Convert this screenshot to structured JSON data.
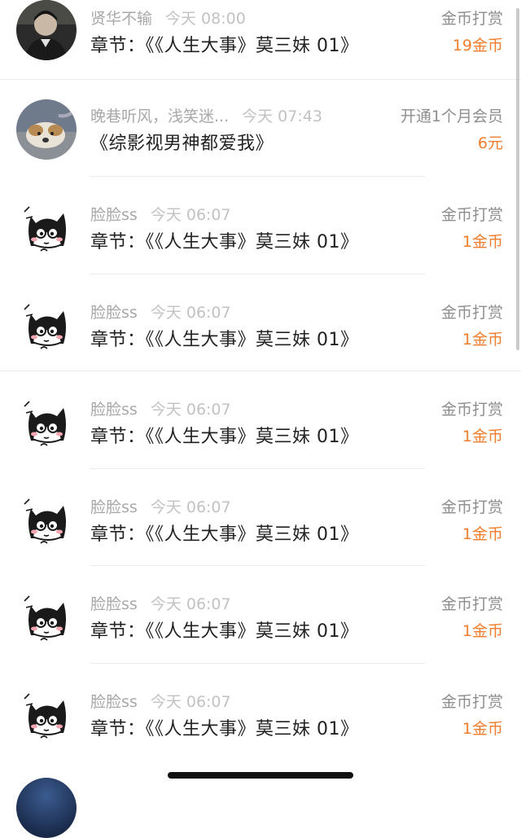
{
  "rows": [
    {
      "user": "贤华不输",
      "time": "今天 08:00",
      "content": "章节：《《人生大事》莫三妹 01》",
      "type": "金币打赏",
      "amount": "19金币",
      "avatar": "photo-man-icon"
    },
    {
      "user": "晚巷听风，浅笑迷...",
      "time": "今天 07:43",
      "content": "《综影视男神都爱我》",
      "type": "开通1个月会员",
      "amount": "6元",
      "avatar": "photo-dog-icon"
    },
    {
      "user": "脸脸ss",
      "time": "今天 06:07",
      "content": "章节：《《人生大事》莫三妹 01》",
      "type": "金币打赏",
      "amount": "1金币",
      "avatar": "cat-sticker-icon"
    },
    {
      "user": "脸脸ss",
      "time": "今天 06:07",
      "content": "章节：《《人生大事》莫三妹 01》",
      "type": "金币打赏",
      "amount": "1金币",
      "avatar": "cat-sticker-icon"
    },
    {
      "user": "脸脸ss",
      "time": "今天 06:07",
      "content": "章节：《《人生大事》莫三妹 01》",
      "type": "金币打赏",
      "amount": "1金币",
      "avatar": "cat-sticker-icon"
    },
    {
      "user": "脸脸ss",
      "time": "今天 06:07",
      "content": "章节：《《人生大事》莫三妹 01》",
      "type": "金币打赏",
      "amount": "1金币",
      "avatar": "cat-sticker-icon"
    },
    {
      "user": "脸脸ss",
      "time": "今天 06:07",
      "content": "章节：《《人生大事》莫三妹 01》",
      "type": "金币打赏",
      "amount": "1金币",
      "avatar": "cat-sticker-icon"
    },
    {
      "user": "脸脸ss",
      "time": "今天 06:07",
      "content": "章节：《《人生大事》莫三妹 01》",
      "type": "金币打赏",
      "amount": "1金币",
      "avatar": "cat-sticker-icon"
    }
  ],
  "colors": {
    "amount": "#f07d2b",
    "meta": "#a8a8a8",
    "content": "#222222"
  }
}
